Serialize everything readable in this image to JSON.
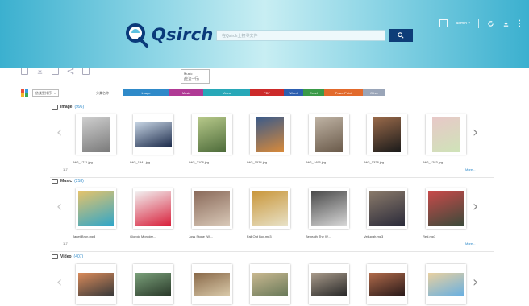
{
  "header": {
    "app_name": "Qsirch",
    "search_placeholder": "在Qsirch上搜寻文件",
    "user_label": "admin ▾"
  },
  "tooltip": {
    "line1": "Music",
    "line2": "(在这一行)"
  },
  "filter": {
    "select_value": "依类型排序",
    "type_label": "分类名称 :",
    "chips": [
      {
        "label": "Image",
        "color": "#2f8ac9",
        "width": 58
      },
      {
        "label": "Music",
        "color": "#b03a95",
        "width": 42
      },
      {
        "label": "Video",
        "color": "#28a8b8",
        "width": 58
      },
      {
        "label": "PDF",
        "color": "#cc2a2a",
        "width": 42
      },
      {
        "label": "Word",
        "color": "#2d5fb0",
        "width": 24
      },
      {
        "label": "Excel",
        "color": "#3a9a48",
        "width": 26
      },
      {
        "label": "PowerPoint",
        "color": "#e26a2c",
        "width": 48
      },
      {
        "label": "Other",
        "color": "#9aa5b8",
        "width": 28
      }
    ]
  },
  "sections": [
    {
      "title": "Image",
      "count": "(996)",
      "pager": "1-7",
      "more": "More...",
      "items": [
        {
          "name": "IMG_1711.jpg",
          "palette": [
            "#7a7a7a",
            "#cfcfcf"
          ]
        },
        {
          "name": "IMG_1941.jpg",
          "palette": [
            "#1b2a4a",
            "#c9d7e6"
          ]
        },
        {
          "name": "IMG_2108.jpg",
          "palette": [
            "#4d6b3a",
            "#b7c98a"
          ]
        },
        {
          "name": "IMG_1534.jpg",
          "palette": [
            "#d98a3a",
            "#3a5a8a"
          ]
        },
        {
          "name": "IMG_1496.jpg",
          "palette": [
            "#6a5a4a",
            "#bfb3a4"
          ]
        },
        {
          "name": "IMG_1328.jpg",
          "palette": [
            "#1a1a1a",
            "#9a6a4a"
          ]
        },
        {
          "name": "IMG_1283.jpg",
          "palette": [
            "#cfe3b8",
            "#e8c8c8"
          ]
        }
      ]
    },
    {
      "title": "Music",
      "count": "(218)",
      "pager": "1-7",
      "more": "More...",
      "items": [
        {
          "name": "Janet Brun.mp3",
          "palette": [
            "#2fa6c9",
            "#e6c36a"
          ]
        },
        {
          "name": "Giorgio Moroder...",
          "palette": [
            "#d81f3a",
            "#f2f2f2"
          ]
        },
        {
          "name": "Joss Stone (Wi...",
          "palette": [
            "#d9c9b8",
            "#8a6a5a"
          ]
        },
        {
          "name": "Fall Out Boy.mp3",
          "palette": [
            "#e8e2c8",
            "#c9963a"
          ]
        },
        {
          "name": "Beneath The W...",
          "palette": [
            "#d8d8d8",
            "#4a4a4a"
          ]
        },
        {
          "name": "Veilupah.mp3",
          "palette": [
            "#2a2a3a",
            "#8a7a6a"
          ]
        },
        {
          "name": "Red.mp3",
          "palette": [
            "#3a4a3a",
            "#c94a4a"
          ]
        }
      ]
    },
    {
      "title": "Video",
      "count": "(407)",
      "pager": "",
      "more": "",
      "items": [
        {
          "name": "",
          "palette": [
            "#3a3a3a",
            "#d98a5a"
          ]
        },
        {
          "name": "",
          "palette": [
            "#2a3a2a",
            "#7aa07a"
          ]
        },
        {
          "name": "",
          "palette": [
            "#d8c8a8",
            "#8a6a4a"
          ]
        },
        {
          "name": "",
          "palette": [
            "#6a7a5a",
            "#c9b890"
          ]
        },
        {
          "name": "",
          "palette": [
            "#2a2a2a",
            "#a89a8a"
          ]
        },
        {
          "name": "",
          "palette": [
            "#2a1a1a",
            "#b06a4a"
          ]
        },
        {
          "name": "",
          "palette": [
            "#6ab0e0",
            "#e8d0a0"
          ]
        }
      ]
    }
  ]
}
